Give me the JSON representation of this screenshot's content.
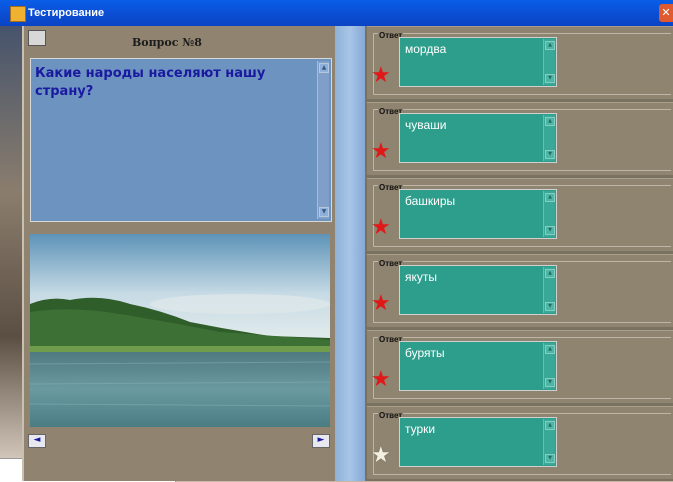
{
  "window": {
    "title": "Тестирование",
    "close_glyph": "✕"
  },
  "question": {
    "number_label": "Вопрос №8",
    "text": "Какие народы населяют нашу страну?"
  },
  "nav": {
    "prev_glyph": "◄",
    "next_glyph": "►"
  },
  "answers": [
    {
      "label": "Ответ",
      "text": "мордва",
      "starred": true
    },
    {
      "label": "Ответ",
      "text": "чуваши",
      "starred": true
    },
    {
      "label": "Ответ",
      "text": "башкиры",
      "starred": true
    },
    {
      "label": "Ответ",
      "text": "якуты",
      "starred": true
    },
    {
      "label": "Ответ",
      "text": "буряты",
      "starred": true
    },
    {
      "label": "Ответ",
      "text": "турки",
      "starred": false
    }
  ],
  "colors": {
    "star_selected": "#e01818",
    "star_unselected": "#f4f0e0",
    "answer_box": "#2e9e8c",
    "question_box": "#6d93c0"
  },
  "icons": {
    "star": "star-icon",
    "app": "app-icon",
    "monitor": "monitor-icon"
  }
}
